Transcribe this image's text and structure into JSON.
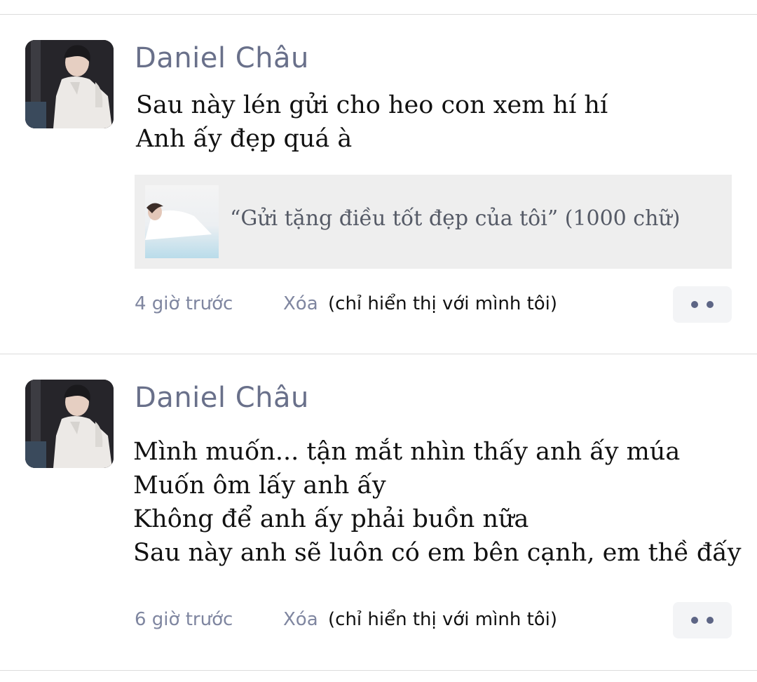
{
  "posts": [
    {
      "author": "Daniel Châu",
      "content": [
        "Sau này lén gửi cho heo con xem hí hí",
        "Anh ấy đẹp quá à"
      ],
      "attachment": {
        "title": "“Gửi tặng điều tốt đẹp của tôi”  (1000 chữ)"
      },
      "time": "4 giờ trước",
      "delete_label": "Xóa",
      "visibility_note": "(chỉ hiển thị với mình tôi)",
      "more_icon": "more-dots-icon"
    },
    {
      "author": "Daniel Châu",
      "content": [
        "Mình muốn... tận mắt nhìn thấy anh ấy múa",
        "Muốn ôm lấy anh ấy",
        "Không để anh ấy phải buồn nữa",
        "Sau này anh sẽ luôn có em bên cạnh, em thề đấy"
      ],
      "time": "6 giờ trước",
      "delete_label": "Xóa",
      "visibility_note": "(chỉ hiển thị với mình tôi)",
      "more_icon": "more-dots-icon"
    }
  ],
  "colors": {
    "author": "#69708a",
    "meta": "#7f86a0",
    "text": "#111111",
    "attachment_bg": "#eeeeee",
    "more_dots": "#5d6585"
  }
}
